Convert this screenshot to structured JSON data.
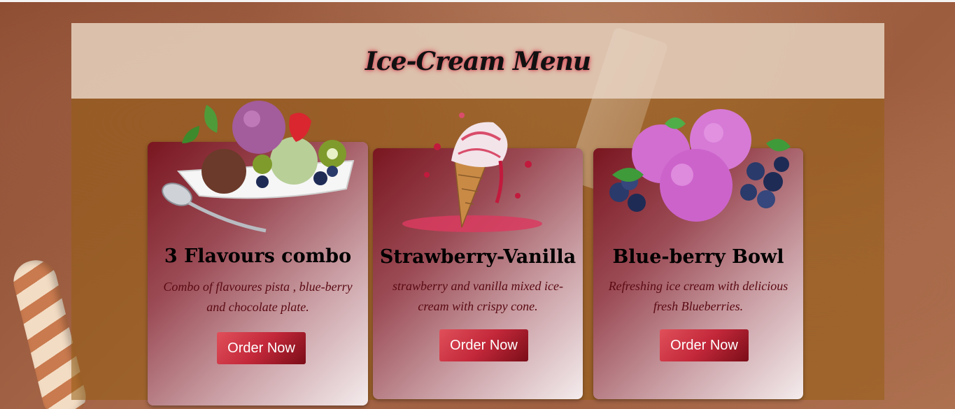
{
  "header": {
    "title": "Ice-Cream Menu"
  },
  "cards": [
    {
      "title": "3 Flavours combo",
      "description": "Combo of flavoures pista , blue-berry and chocolate plate.",
      "button_label": "Order Now",
      "image_icon": "ice-cream-bowl-icon"
    },
    {
      "title": "Strawberry-Vanilla",
      "description": "strawberry and vanilla mixed ice-cream with crispy cone.",
      "button_label": "Order Now",
      "image_icon": "ice-cream-cone-icon"
    },
    {
      "title": "Blue-berry Bowl",
      "description": "Refreshing ice cream with delicious fresh Blueberries.",
      "button_label": "Order Now",
      "image_icon": "blueberry-scoops-icon"
    }
  ],
  "colors": {
    "card_dark": "#7a1620",
    "card_light": "#f4eced",
    "button_red": "#c3283a",
    "header_band": "#e8d4c4",
    "panel_overlay": "#965f14"
  }
}
